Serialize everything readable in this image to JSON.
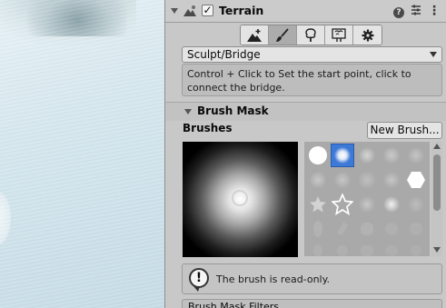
{
  "component": {
    "title": "Terrain",
    "enabled": true,
    "icons": [
      "terrain-component-icon",
      "help-icon",
      "preset-icon",
      "more-options-icon"
    ]
  },
  "toolbar": {
    "tools": [
      {
        "name": "raise-lower-tool-icon",
        "active": false
      },
      {
        "name": "paint-brush-tool-icon",
        "active": true
      },
      {
        "name": "paint-trees-tool-icon",
        "active": false
      },
      {
        "name": "paint-details-tool-icon",
        "active": false
      },
      {
        "name": "terrain-settings-gear-icon",
        "active": false
      }
    ]
  },
  "tool_dropdown": {
    "value": "Sculpt/Bridge"
  },
  "tool_description": "Control + Click to Set the start point, click to connect the bridge.",
  "brush_mask": {
    "header": "Brush Mask",
    "brushes_label": "Brushes",
    "new_brush_label": "New Brush...",
    "selected_brush_index": 1,
    "readonly_message": "The brush is read-only.",
    "filters_label": "Brush Mask Filters"
  },
  "colors": {
    "selected_brush": "#3d79d6",
    "panel_bg": "#c8c8c8"
  }
}
